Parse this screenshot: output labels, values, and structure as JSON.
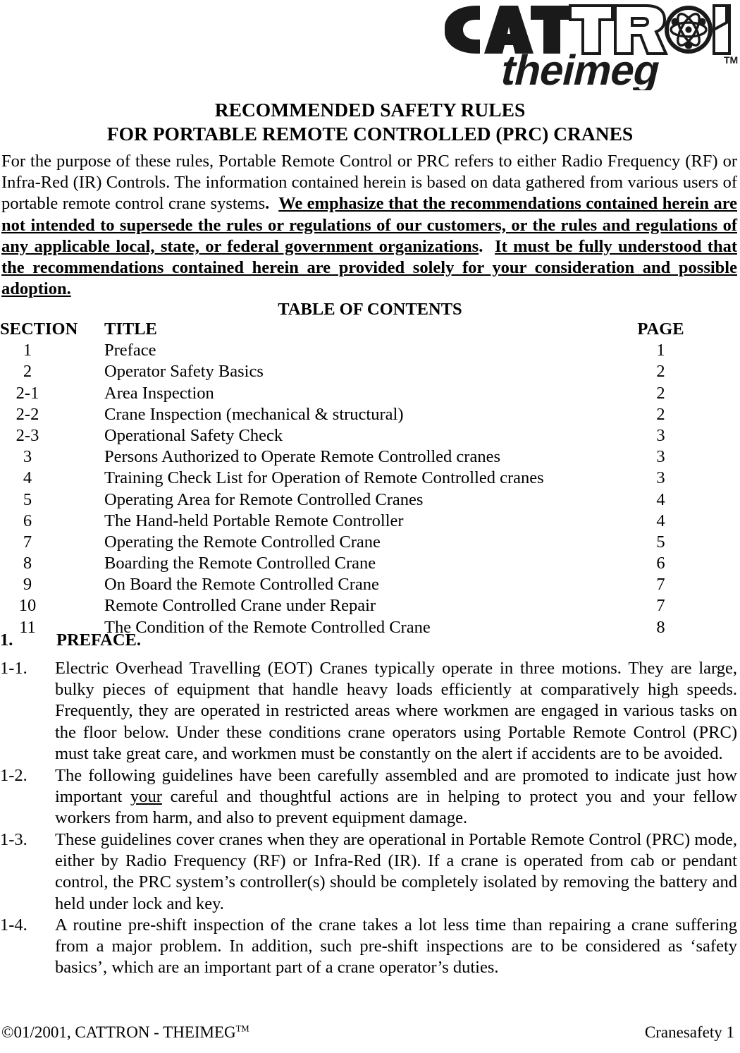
{
  "logo": {
    "brand_top": "CATTRON",
    "brand_bottom": "theimeg",
    "trademark": "TM",
    "atom_icon": "atom-icon"
  },
  "title": {
    "line1": "RECOMMENDED SAFETY RULES",
    "line2": "FOR PORTABLE REMOTE CONTROLLED (PRC) CRANES"
  },
  "intro": {
    "plain_part": "For the purpose of these rules, Portable Remote Control or PRC refers to either Radio Frequency (RF) or Infra-Red (IR) Controls. The information contained herein is based on data gathered from various users of portable remote control crane systems",
    "plain_period": ".",
    "emphasis_1": "We emphasize that the recommendations contained herein are not intended to supersede the rules or regulations of our customers, or the rules and regulations of any applicable local, state, or federal government organizations",
    "separator_period": ".",
    "emphasis_2": "It must be fully understood that the recommendations contained herein are provided solely for your consideration and possible adoption."
  },
  "toc": {
    "heading": "TABLE OF CONTENTS",
    "columns": {
      "section": "SECTION",
      "title": "TITLE",
      "page": "PAGE"
    },
    "rows": [
      {
        "section": "1",
        "title": "Preface",
        "page": "1"
      },
      {
        "section": "2",
        "title": "Operator Safety Basics",
        "page": "2"
      },
      {
        "section": "2-1",
        "title": "Area Inspection",
        "page": "2"
      },
      {
        "section": "2-2",
        "title": "Crane Inspection (mechanical & structural)",
        "page": "2"
      },
      {
        "section": "2-3",
        "title": "Operational Safety Check",
        "page": "3"
      },
      {
        "section": "3",
        "title": "Persons Authorized to Operate Remote Controlled cranes",
        "page": "3"
      },
      {
        "section": "4",
        "title": "Training Check List for Operation of Remote Controlled cranes",
        "page": "3"
      },
      {
        "section": "5",
        "title": "Operating Area for Remote Controlled Cranes",
        "page": "4"
      },
      {
        "section": "6",
        "title": "The Hand-held Portable Remote Controller",
        "page": "4"
      },
      {
        "section": "7",
        "title": "Operating the Remote Controlled Crane",
        "page": "5"
      },
      {
        "section": "8",
        "title": "Boarding the Remote Controlled Crane",
        "page": "6"
      },
      {
        "section": "9",
        "title": "On Board the Remote Controlled Crane",
        "page": "7"
      },
      {
        "section": "10",
        "title": "Remote Controlled Crane under Repair",
        "page": "7"
      },
      {
        "section": "11",
        "title": "The Condition of the Remote Controlled Crane",
        "page": "8"
      }
    ]
  },
  "section1": {
    "number": "1.",
    "label": "PREFACE.",
    "paragraphs": [
      {
        "number": "1-1.",
        "text": "Electric Overhead Travelling (EOT) Cranes typically operate in three motions.  They are large, bulky pieces of equipment that handle heavy loads efficiently at comparatively high speeds.  Frequently, they are operated in restricted areas where workmen are engaged in various tasks on the floor below.  Under these conditions crane operators using Portable Remote Control (PRC) must take great care, and workmen must be constantly on the alert if accidents are to be avoided."
      },
      {
        "number": "1-2.",
        "text_before": "The following guidelines have been carefully assembled and are promoted to indicate just how important ",
        "underlined": "your",
        "text_after": " careful and thoughtful actions are in helping to protect you and your fellow workers from harm, and also to prevent equipment damage."
      },
      {
        "number": "1-3.",
        "text": "These guidelines cover cranes when they are operational in Portable Remote Control (PRC) mode, either by Radio Frequency (RF) or Infra-Red (IR).  If a crane is operated from cab or pendant control, the PRC system’s controller(s) should be completely isolated by removing the battery and held under lock and key."
      },
      {
        "number": "1-4.",
        "text": "A routine pre-shift inspection of the crane takes a lot less time than repairing a crane suffering from a major problem.  In addition, such pre-shift inspections are to be considered as ‘safety basics’, which are an important part of a crane operator’s duties."
      }
    ]
  },
  "footer": {
    "copyright": "©01/2001, CATTRON - THEIMEG",
    "copyright_tm": "TM",
    "page_label": "Cranesafety 1"
  }
}
